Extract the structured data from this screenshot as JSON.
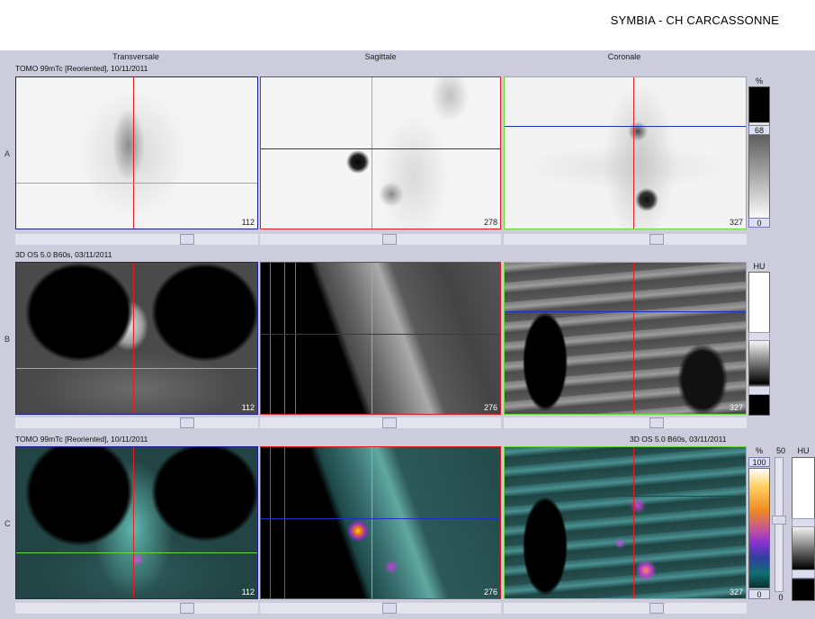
{
  "header": {
    "title": "SYMBIA - CH CARCASSONNE"
  },
  "columns": [
    "Transversale",
    "Sagittale",
    "Coronale"
  ],
  "rows": [
    {
      "letter": "A",
      "series": "TOMO 99mTc [Reoriented], 10/11/2011",
      "series_right": ""
    },
    {
      "letter": "B",
      "series": "3D  OS  5.0  B60s, 03/11/2011",
      "series_right": ""
    },
    {
      "letter": "C",
      "series": "TOMO 99mTc [Reoriented], 10/11/2011",
      "series_right": "3D  OS  5.0  B60s, 03/11/2011"
    }
  ],
  "slices": {
    "transversale": "112",
    "sagittale": "276",
    "coronale": "327",
    "sagittale_a": "278"
  },
  "colorbars": {
    "a_unit": "%",
    "a_top": "68",
    "a_bottom": "0",
    "b_unit": "HU",
    "c_unit": "%",
    "c_top": "100",
    "c_bottom": "0",
    "c_ct_unit": "HU",
    "c_mid": "50",
    "c_low": "0"
  },
  "colors": {
    "crosshair_red": "#e02020",
    "crosshair_green": "#6ad83a",
    "crosshair_blue": "#2030c0",
    "frame_blue": "#20209a"
  }
}
